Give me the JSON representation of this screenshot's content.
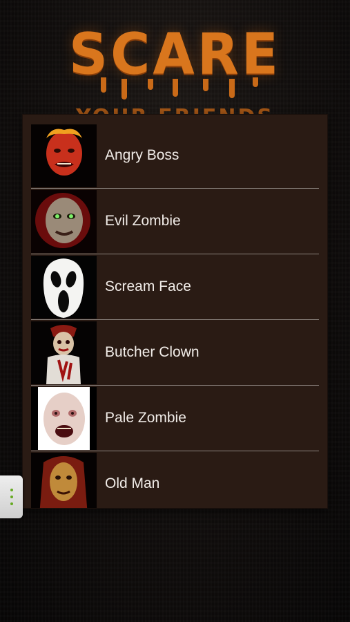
{
  "logo": {
    "title": "SCARE",
    "subtitle": "YOUR FRIENDS"
  },
  "list": {
    "items": [
      {
        "label": "Angry Boss",
        "icon": "angry-boss-face"
      },
      {
        "label": "Evil Zombie",
        "icon": "evil-zombie-face"
      },
      {
        "label": "Scream Face",
        "icon": "scream-mask-face"
      },
      {
        "label": "Butcher Clown",
        "icon": "butcher-clown-face"
      },
      {
        "label": "Pale Zombie",
        "icon": "pale-zombie-face"
      },
      {
        "label": "Old Man",
        "icon": "old-man-face"
      }
    ]
  },
  "colors": {
    "accent": "#d9761d",
    "panel": "#2a1b14",
    "text": "#f1ece8",
    "handle_dots": "#66aa22"
  },
  "side_handle": {
    "icon": "vertical-dots-icon"
  }
}
